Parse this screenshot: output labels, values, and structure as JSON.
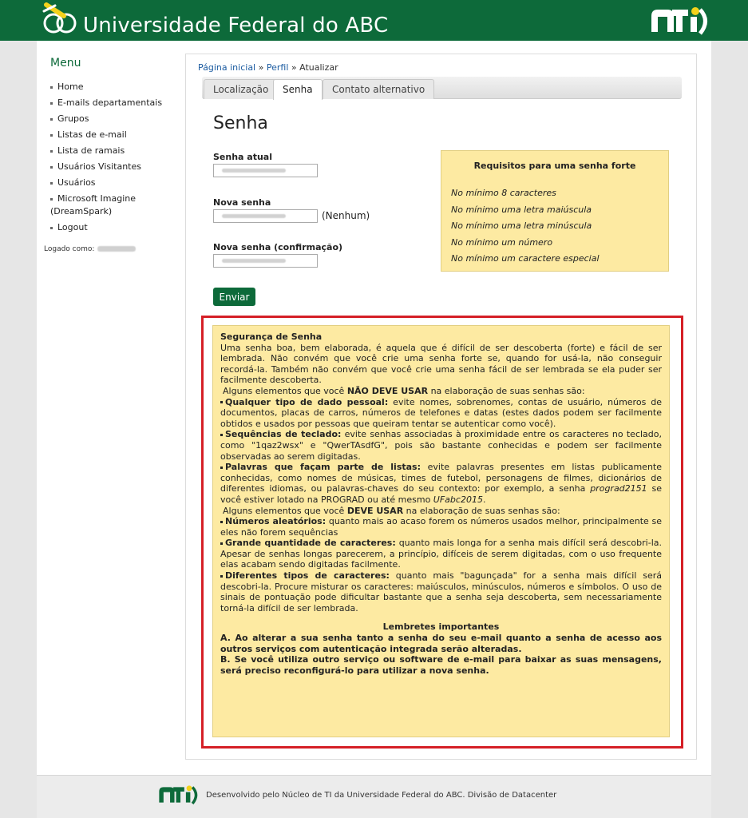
{
  "header": {
    "title": "Universidade Federal do ABC",
    "brand_color": "#0d6a3a",
    "logo_icon": "ufabc-logo-icon",
    "nti_icon": "nti-logo-icon"
  },
  "sidebar": {
    "title": "Menu",
    "items": [
      {
        "label": "Home"
      },
      {
        "label": "E-mails departamentais"
      },
      {
        "label": "Grupos"
      },
      {
        "label": "Listas de e-mail"
      },
      {
        "label": "Lista de ramais"
      },
      {
        "label": "Usuários Visitantes"
      },
      {
        "label": "Usuários"
      },
      {
        "label": "Microsoft Imagine (DreamSpark)"
      },
      {
        "label": "Logout"
      }
    ],
    "logged_label": "Logado como:"
  },
  "breadcrumb": {
    "home": "Página inicial",
    "sep1": " » ",
    "perfil": "Perfil",
    "sep2": " » ",
    "current": "Atualizar"
  },
  "tabs": [
    {
      "label": "Localização"
    },
    {
      "label": "Senha"
    },
    {
      "label": "Contato alternativo"
    }
  ],
  "form": {
    "title": "Senha",
    "current_password_label": "Senha atual",
    "new_password_label": "Nova senha",
    "strength": "(Nenhum)",
    "confirm_label": "Nova senha (confirmação)",
    "submit": "Enviar"
  },
  "requirements": {
    "title": "Requisitos para uma senha forte",
    "items": [
      "No mínimo 8 caracteres",
      "No mínimo uma letra maiúscula",
      "No mínimo uma letra minúscula",
      "No mínimo um número",
      "No mínimo um caractere especial"
    ]
  },
  "security": {
    "title": "Segurança de Senha",
    "intro": "Uma senha boa, bem elaborada, é aquela que é difícil de ser descoberta (forte) e fácil de ser lembrada. Não convém que você crie uma senha forte se, quando for usá-la, não conseguir recordá-la. Também não convém que você crie uma senha fácil de ser lembrada se ela puder ser facilmente descoberta.",
    "dont_pre": "Alguns elementos que você ",
    "dont_strong": "NÃO DEVE USAR",
    "dont_post": " na elaboração de suas senhas são:",
    "dont_items": [
      {
        "title": "Qualquer tipo de dado pessoal:",
        "text": " evite nomes, sobrenomes, contas de usuário, números de documentos, placas de carros, números de telefones e datas (estes dados podem ser facilmente obtidos e usados por pessoas que queiram tentar se autenticar como você)."
      },
      {
        "title": "Sequências de teclado:",
        "text": " evite senhas associadas à proximidade entre os caracteres no teclado, como \"1qaz2wsx\" e \"QwerTAsdfG\", pois são bastante conhecidas e podem ser facilmente observadas ao serem digitadas."
      },
      {
        "title": "Palavras que façam parte de listas:",
        "text": " evite palavras presentes em listas publicamente conhecidas, como nomes de músicas, times de futebol, personagens de filmes, dicionários de diferentes idiomas, ou palavras-chaves do seu contexto: por exemplo, a senha ",
        "em1": "prograd2151",
        "mid": " se você estiver lotado na PROGRAD ou até mesmo ",
        "em2": "UFabc2015",
        "end": "."
      }
    ],
    "do_pre": "Alguns elementos que você ",
    "do_strong": "DEVE USAR",
    "do_post": " na elaboração de suas senhas são:",
    "do_items": [
      {
        "title": "Números aleatórios:",
        "text": " quanto mais ao acaso forem os números usados melhor, principalmente se eles não forem sequências"
      },
      {
        "title": "Grande quantidade de caracteres:",
        "text": " quanto mais longa for a senha mais difícil será descobri-la. Apesar de senhas longas parecerem, a princípio, difíceis de serem digitadas, com o uso frequente elas acabam sendo digitadas facilmente."
      },
      {
        "title": "Diferentes tipos de caracteres:",
        "text": " quanto mais \"bagunçada\" for a senha mais difícil será descobri-la. Procure misturar os caracteres: maiúsculos, minúsculos, números e símbolos. O uso de sinais de pontuação pode dificultar bastante que a senha seja descoberta, sem necessariamente torná-la difícil de ser lembrada."
      }
    ],
    "reminders_title": "Lembretes importantes",
    "reminder_a": "A. Ao alterar a sua senha tanto a senha do seu e-mail quanto a senha de acesso aos outros serviços com autenticação integrada serão alteradas.",
    "reminder_b": "B. Se você utiliza outro serviço ou software de e-mail para baixar as suas mensagens, será preciso reconfigurá-lo para utilizar a nova senha.",
    "highlight_color": "#d51f26"
  },
  "footer": {
    "text": "Desenvolvido pelo Núcleo de TI da Universidade Federal do ABC. Divisão de Datacenter"
  }
}
